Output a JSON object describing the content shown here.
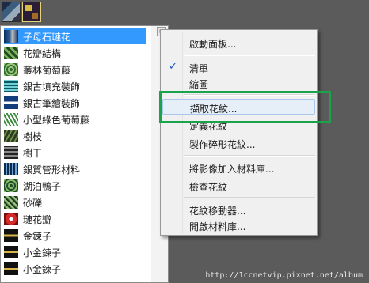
{
  "pattern_list": {
    "menu_arrow": "▸",
    "items": [
      {
        "label": "子母石璉花",
        "selected": true
      },
      {
        "label": "花瓣結構"
      },
      {
        "label": "叢林葡萄藤"
      },
      {
        "label": "銀古填充裝飾"
      },
      {
        "label": "銀古筆繪裝飾"
      },
      {
        "label": "小型綠色葡萄藤"
      },
      {
        "label": "樹枝"
      },
      {
        "label": "樹干"
      },
      {
        "label": "銀質管形材料"
      },
      {
        "label": "湖泊鴨子"
      },
      {
        "label": "砂礫"
      },
      {
        "label": "璉花瓣"
      },
      {
        "label": "金鍊子"
      },
      {
        "label": "小金鍊子"
      },
      {
        "label": "小金鍊子"
      }
    ]
  },
  "context_menu": {
    "items": [
      {
        "label": "啟動面板..."
      },
      {
        "label": "清單",
        "checked": true,
        "check_glyph": "✓"
      },
      {
        "label": "縮圖"
      },
      {
        "label": "擷取花紋...",
        "hovered": true
      },
      {
        "label": "定義花紋"
      },
      {
        "label": "製作碎形花紋..."
      },
      {
        "label": "將影像加入材料庫..."
      },
      {
        "label": "檢查花紋"
      },
      {
        "label": "花紋移動器..."
      },
      {
        "label": "開啟材料庫..."
      }
    ]
  },
  "watermark": "http://1ccnetvip.pixnet.net/album",
  "colors": {
    "selection": "#3399ff",
    "highlight_box": "#1aa34a",
    "check": "#1c56c9"
  }
}
